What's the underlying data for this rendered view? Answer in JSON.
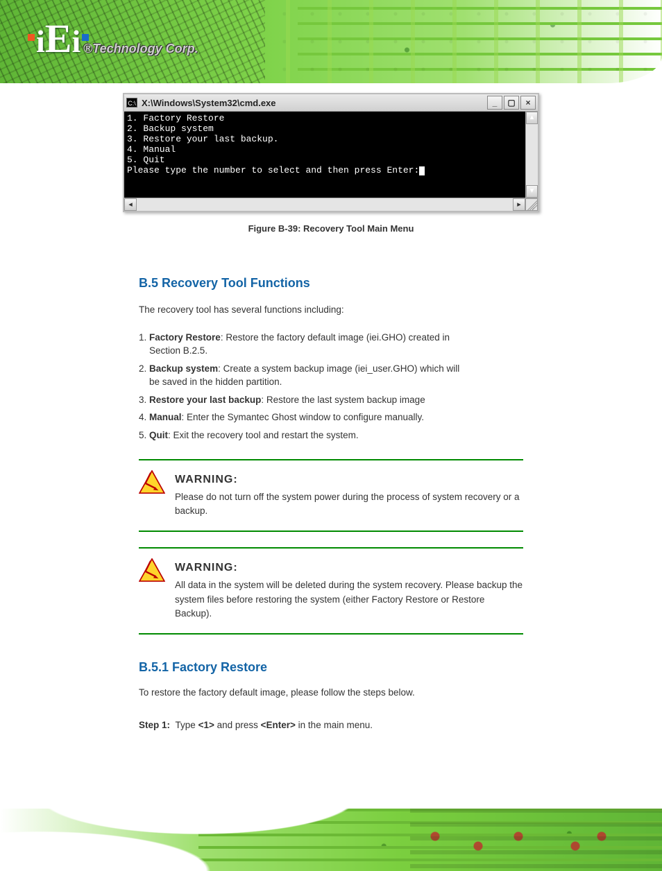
{
  "logo": {
    "brand": "iEi",
    "tagline": "®Technology Corp."
  },
  "cmd": {
    "icon_label": "C:\\",
    "title": "X:\\Windows\\System32\\cmd.exe",
    "min": "_",
    "max": "▢",
    "close": "×",
    "lines": {
      "l1": "1. Factory Restore",
      "l2": "2. Backup system",
      "l3": "3. Restore your last backup.",
      "l4": "4. Manual",
      "l5": "5. Quit",
      "l6": "Please type the number to select and then press Enter:"
    },
    "up": "▴",
    "down": "▾",
    "left": "◂",
    "right": "▸"
  },
  "figure": {
    "caption": "Figure B-39: Recovery Tool Main Menu"
  },
  "intro": "The recovery tool has several functions including:",
  "heading": "B.5  Recovery Tool Functions",
  "bullets": {
    "b1_num": "1.",
    "b1_label": "Factory Restore",
    "b1_text": ": Restore the factory default image (iei.GHO) created in",
    "b1_sub": "Section B.2.5.",
    "b2_num": "2.",
    "b2_label": "Backup system",
    "b2_text": ": Create a system backup image (iei_user.GHO) which will",
    "b2_sub": "be saved in the hidden partition.",
    "b3_num": "3.",
    "b3_label": "Restore your last backup",
    "b3_text": ": Restore the last system backup image",
    "b4_num": "4.",
    "b4_label": "Manual",
    "b4_text": ": Enter the Symantec Ghost window to configure manually.",
    "b5_num": "5.",
    "b5_label": "Quit",
    "b5_text": ": Exit the recovery tool and restart the system."
  },
  "warnings": {
    "label": "WARNING:",
    "w1": "Please do not turn off the system power during the process of system recovery or a backup.",
    "w2": "All data in the system will be deleted during the system recovery. Please backup the system files before restoring the system (either Factory Restore or Restore Backup)."
  },
  "section": {
    "num_title": "B.5.1 Factory Restore",
    "desc": "To restore the factory default image, please follow the steps below.",
    "step_lead": "Step 1:",
    "step_body_a": "Type ",
    "step_body_key": "<1>",
    "step_body_b": " and press ",
    "step_body_key2": "<Enter>",
    "step_body_c": " in the main menu."
  }
}
